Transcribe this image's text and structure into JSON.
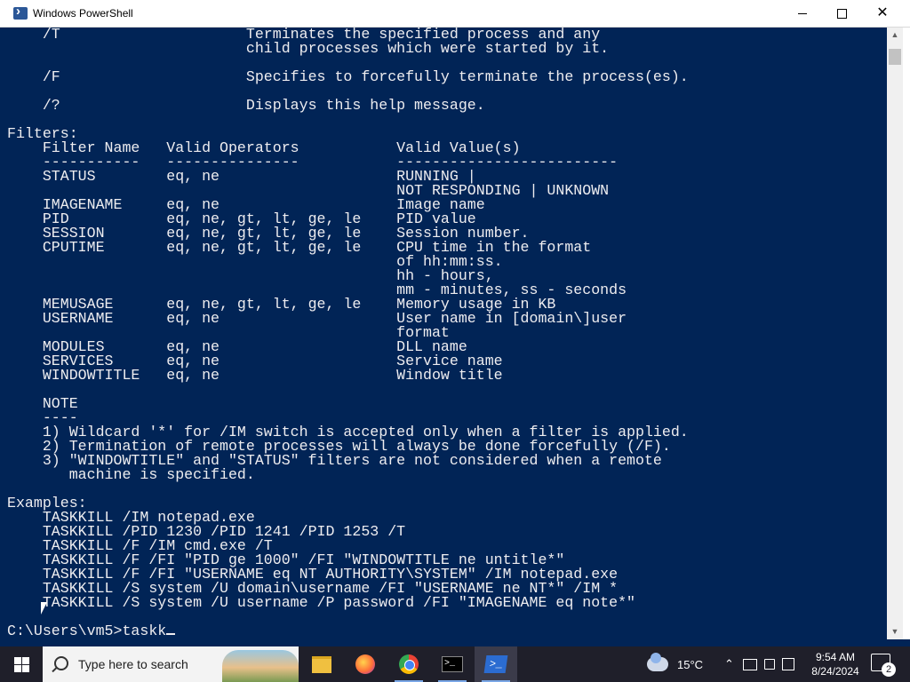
{
  "window": {
    "title": "Windows PowerShell",
    "minimize_icon": "minimize-icon",
    "maximize_icon": "maximize-icon",
    "close_glyph": "✕"
  },
  "console": {
    "lines": [
      "    /T                     Terminates the specified process and any",
      "                           child processes which were started by it.",
      "",
      "    /F                     Specifies to forcefully terminate the process(es).",
      "",
      "    /?                     Displays this help message.",
      "",
      "Filters:",
      "    Filter Name   Valid Operators           Valid Value(s)",
      "    -----------   ---------------           -------------------------",
      "    STATUS        eq, ne                    RUNNING |",
      "                                            NOT RESPONDING | UNKNOWN",
      "    IMAGENAME     eq, ne                    Image name",
      "    PID           eq, ne, gt, lt, ge, le    PID value",
      "    SESSION       eq, ne, gt, lt, ge, le    Session number.",
      "    CPUTIME       eq, ne, gt, lt, ge, le    CPU time in the format",
      "                                            of hh:mm:ss.",
      "                                            hh - hours,",
      "                                            mm - minutes, ss - seconds",
      "    MEMUSAGE      eq, ne, gt, lt, ge, le    Memory usage in KB",
      "    USERNAME      eq, ne                    User name in [domain\\]user",
      "                                            format",
      "    MODULES       eq, ne                    DLL name",
      "    SERVICES      eq, ne                    Service name",
      "    WINDOWTITLE   eq, ne                    Window title",
      "",
      "    NOTE",
      "    ----",
      "    1) Wildcard '*' for /IM switch is accepted only when a filter is applied.",
      "    2) Termination of remote processes will always be done forcefully (/F).",
      "    3) \"WINDOWTITLE\" and \"STATUS\" filters are not considered when a remote",
      "       machine is specified.",
      "",
      "Examples:",
      "    TASKKILL /IM notepad.exe",
      "    TASKKILL /PID 1230 /PID 1241 /PID 1253 /T",
      "    TASKKILL /F /IM cmd.exe /T",
      "    TASKKILL /F /FI \"PID ge 1000\" /FI \"WINDOWTITLE ne untitle*\"",
      "    TASKKILL /F /FI \"USERNAME eq NT AUTHORITY\\SYSTEM\" /IM notepad.exe",
      "    TASKKILL /S system /U domain\\username /FI \"USERNAME ne NT*\" /IM *",
      "    TASKKILL /S system /U username /P password /FI \"IMAGENAME eq note*\"",
      ""
    ],
    "prompt": "C:\\Users\\vm5>",
    "input": "taskk"
  },
  "scrollbar": {
    "up_glyph": "▲",
    "down_glyph": "▼"
  },
  "taskbar": {
    "search_placeholder": "Type here to search",
    "cmd_glyph": ">_",
    "ps_glyph": ">_",
    "weather_temp": "15°C",
    "tray_chevron": "⌃",
    "clock_time": "9:54 AM",
    "clock_date": "8/24/2024",
    "notification_count": "2",
    "colors": {
      "taskbar_bg": "#1f1f2a",
      "console_bg": "#012456",
      "console_fg": "#eeedf0"
    }
  }
}
